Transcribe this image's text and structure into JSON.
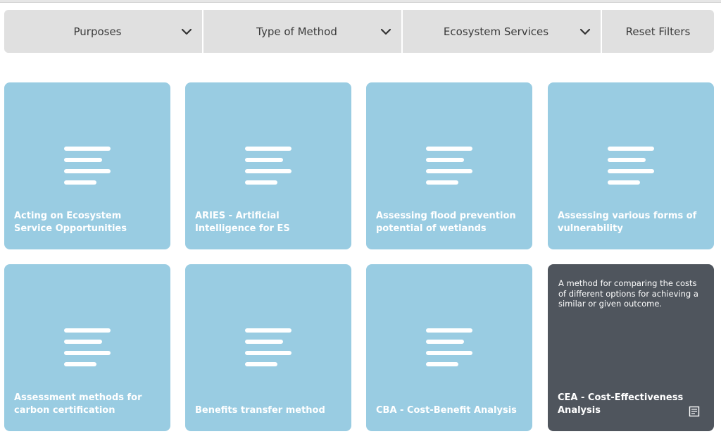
{
  "filters": [
    {
      "label": "Purposes",
      "icon": "chevron-down-icon"
    },
    {
      "label": "Type of Method",
      "icon": "chevron-down-icon"
    },
    {
      "label": "Ecosystem Services",
      "icon": "chevron-down-icon"
    },
    {
      "label": "Reset Filters"
    }
  ],
  "cards": [
    {
      "title": "Acting on Ecosystem Service Opportunities",
      "icon": "text-lines-icon"
    },
    {
      "title": "ARIES - Artificial Intelligence for ES",
      "icon": "text-lines-icon"
    },
    {
      "title": "Assessing flood prevention potential of wetlands",
      "icon": "text-lines-icon"
    },
    {
      "title": "Assessing various forms of vulnerability",
      "icon": "text-lines-icon"
    },
    {
      "title": "Assessment methods for carbon certification",
      "icon": "text-lines-icon"
    },
    {
      "title": "Benefits transfer method",
      "icon": "text-lines-icon"
    },
    {
      "title": "CBA - Cost-Benefit Analysis",
      "icon": "text-lines-icon"
    },
    {
      "title": "CEA - Cost-Effectiveness Analysis",
      "description": "A method for comparing the costs of different options for achieving a similar or given outcome.",
      "icon": "document-icon",
      "state": "hovered"
    }
  ],
  "colors": {
    "card": "#99cce2",
    "card_hover": "#4f555d",
    "filterbar": "#e0e0e0",
    "text_light": "#ffffff",
    "text_dark": "#3a3a3a"
  }
}
